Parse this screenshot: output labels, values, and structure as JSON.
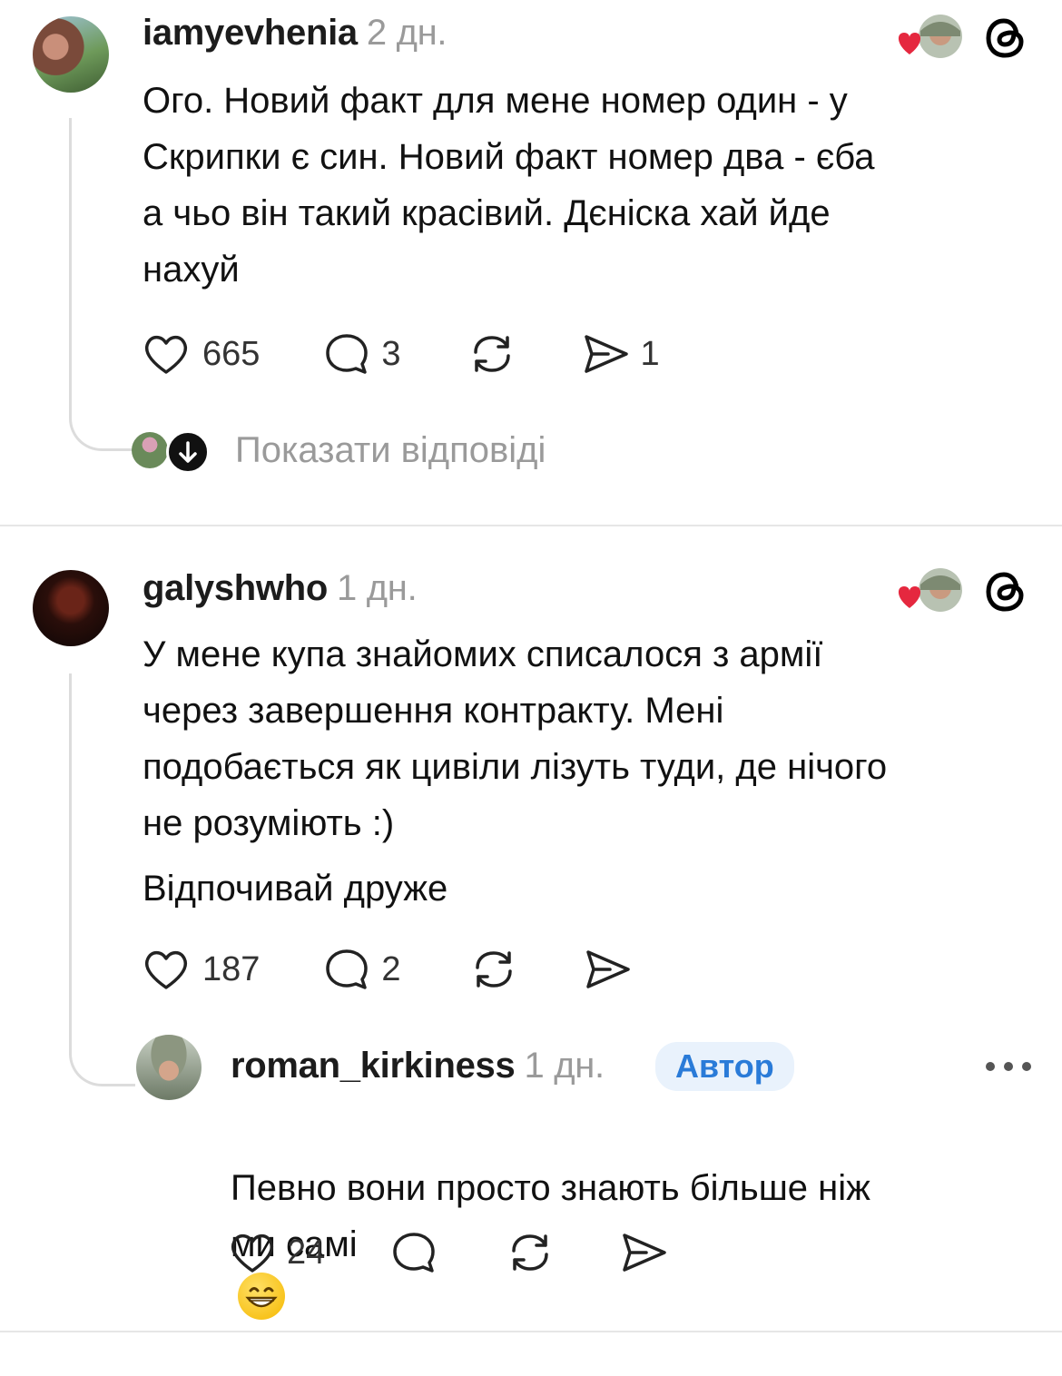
{
  "colors": {
    "heart": "#e5283f",
    "badge_bg": "#e9f2fc",
    "badge_text": "#2a7bd8",
    "muted": "#9a9a9a"
  },
  "comments": [
    {
      "username": "iamyevhenia",
      "time": "2 дн.",
      "text": "Ого. Новий факт для мене номер один - у\nСкрипки є син. Новий факт номер два - єба\nа чьо він такий красівий. Дєніска хай йде\nнахуй",
      "likes": "665",
      "replies": "3",
      "shares": "1",
      "show_replies": "Показати відповіді"
    },
    {
      "username": "galyshwho",
      "time": "1 дн.",
      "text": "У мене купа знайомих списалося з армії\nчерез завершення контракту. Мені\nподобається як цивіли лізуть туди, де нічого\nне розуміють :)",
      "text2": "Відпочивай друже",
      "likes": "187",
      "replies": "2",
      "reply": {
        "username": "roman_kirkiness",
        "time": "1 дн.",
        "badge": "Автор",
        "text": "Певно вони просто знають більше ніж\nми самі",
        "emoji": "😁",
        "likes": "24"
      }
    }
  ],
  "icons": [
    "heart-icon",
    "comment-icon",
    "repost-icon",
    "share-icon",
    "threads-logo-icon",
    "more-icon",
    "arrow-down-icon"
  ]
}
